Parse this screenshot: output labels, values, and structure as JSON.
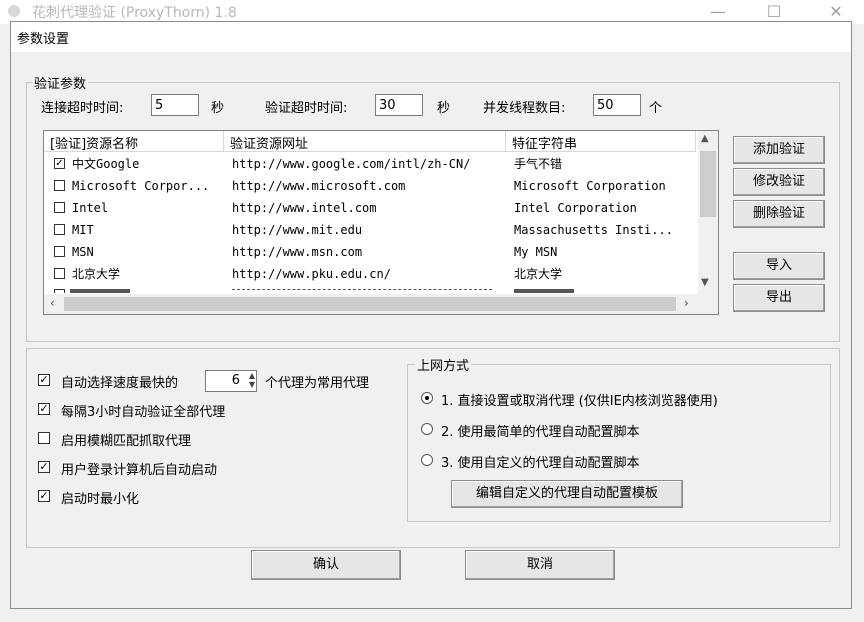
{
  "app_title": "花刺代理验证 (ProxyThorn) 1.8",
  "dialog": {
    "title": "参数设置",
    "verify_group": {
      "label": "验证参数",
      "connect_timeout_label": "连接超时时间:",
      "connect_timeout_value": "5",
      "connect_timeout_unit": "秒",
      "verify_timeout_label": "验证超时时间:",
      "verify_timeout_value": "30",
      "verify_timeout_unit": "秒",
      "threads_label": "并发线程数目:",
      "threads_value": "50",
      "threads_unit": "个"
    },
    "list": {
      "columns": [
        "[验证]资源名称",
        "验证资源网址",
        "特征字符串"
      ],
      "rows": [
        {
          "checked": true,
          "name": "中文Google",
          "url": "http://www.google.com/intl/zh-CN/",
          "feature": "手气不错"
        },
        {
          "checked": false,
          "name": "Microsoft Corpor...",
          "url": "http://www.microsoft.com",
          "feature": "Microsoft Corporation"
        },
        {
          "checked": false,
          "name": "Intel",
          "url": "http://www.intel.com",
          "feature": "Intel Corporation"
        },
        {
          "checked": false,
          "name": "MIT",
          "url": "http://www.mit.edu",
          "feature": "Massachusetts Insti..."
        },
        {
          "checked": false,
          "name": "MSN",
          "url": "http://www.msn.com",
          "feature": "My MSN"
        },
        {
          "checked": false,
          "name": "北京大学",
          "url": "http://www.pku.edu.cn/",
          "feature": "北京大学"
        }
      ]
    },
    "side_buttons": {
      "add": "添加验证",
      "edit": "修改验证",
      "delete": "删除验证",
      "import": "导入",
      "export": "导出"
    },
    "options": {
      "auto_select_prefix": "自动选择速度最快的",
      "auto_select_count": "6",
      "auto_select_suffix": "个代理为常用代理",
      "auto_verify_3h": "每隔3小时自动验证全部代理",
      "fuzzy_match": "启用模糊匹配抓取代理",
      "autostart": "用户登录计算机后自动启动",
      "minimize": "启动时最小化",
      "checked": {
        "auto_select": true,
        "auto_verify_3h": true,
        "fuzzy_match": false,
        "autostart": true,
        "minimize": true
      }
    },
    "network": {
      "label": "上网方式",
      "options": [
        "1. 直接设置或取消代理 (仅供IE内核浏览器使用)",
        "2. 使用最简单的代理自动配置脚本",
        "3. 使用自定义的代理自动配置脚本"
      ],
      "selected": 0,
      "edit_template_button": "编辑自定义的代理自动配置模板"
    },
    "ok_button": "确认",
    "cancel_button": "取消"
  }
}
